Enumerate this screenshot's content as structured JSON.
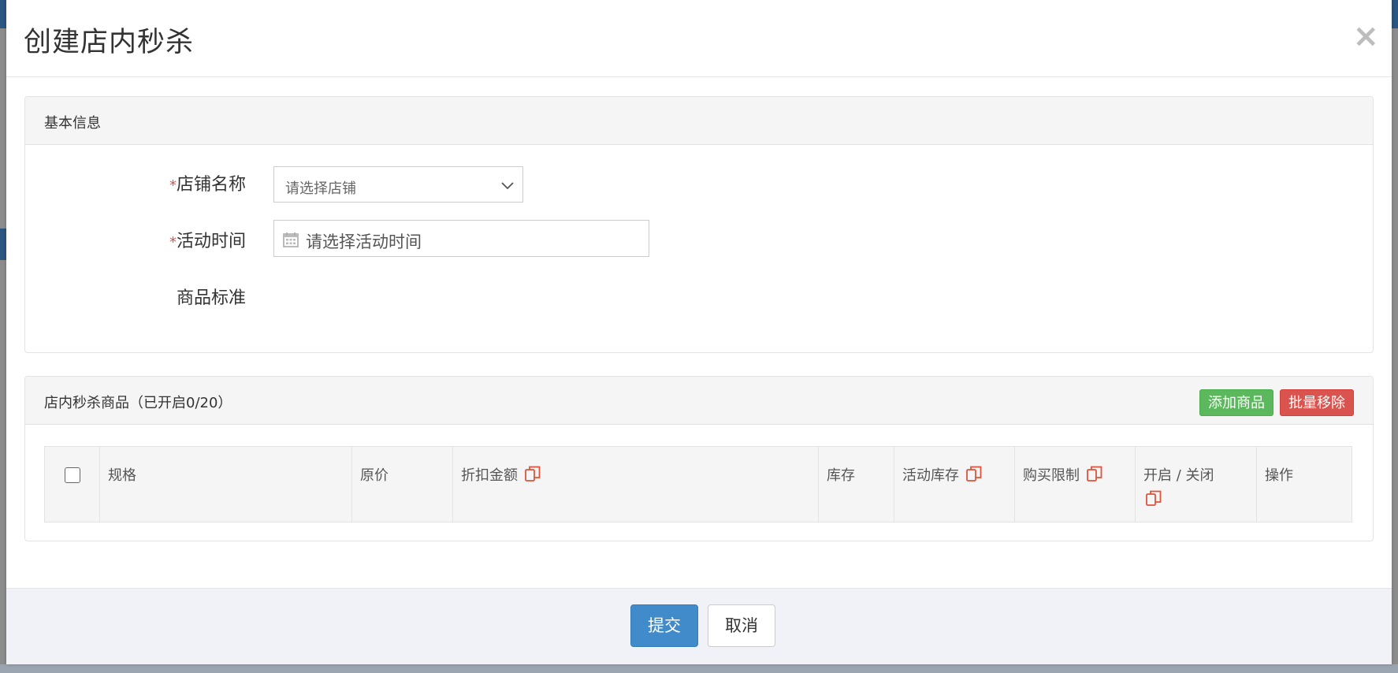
{
  "modal": {
    "title": "创建店内秒杀",
    "close_glyph": "×"
  },
  "basic_info": {
    "title": "基本信息",
    "required_mark": "*",
    "store_label": "店铺名称",
    "store_placeholder": "请选择店铺",
    "time_label": "活动时间",
    "time_placeholder": "请选择活动时间",
    "standard_label": "商品标准"
  },
  "goods": {
    "title": "店内秒杀商品（已开启0/20）",
    "add_button": "添加商品",
    "remove_button": "批量移除",
    "columns": [
      "规格",
      "原价",
      "折扣金额",
      "库存",
      "活动库存",
      "购买限制",
      "开启 / 关闭",
      "操作"
    ]
  },
  "footer": {
    "submit": "提交",
    "cancel": "取消"
  },
  "colors": {
    "primary": "#428bca",
    "success": "#5cb85c",
    "danger": "#d9534f",
    "copy_icon": "#e0533b"
  },
  "icons": {
    "close": "close-icon",
    "select": "chevron-down-icon",
    "date": "calendar-icon",
    "batch": "copy-icon"
  }
}
